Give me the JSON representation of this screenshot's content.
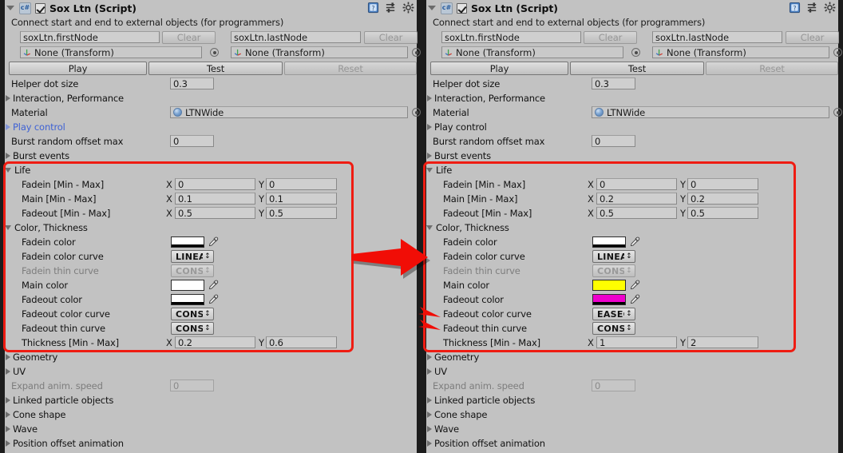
{
  "component": {
    "title": "Sox Ltn (Script)",
    "enabled_checkbox": true,
    "script_icon": "c#",
    "help_text": "Connect start and end to external objects (for programmers)",
    "icons": [
      "help-icon",
      "preset-icon",
      "gear-icon"
    ]
  },
  "node_fields": {
    "first_node_value": "soxLtn.firstNode",
    "last_node_value": "soxLtn.lastNode",
    "clear_label": "Clear",
    "first_object_value": "None (Transform)",
    "last_object_value": "None (Transform)"
  },
  "action_buttons": {
    "play": "Play",
    "test": "Test",
    "reset": "Reset"
  },
  "common_rows": {
    "helper_dot_size_label": "Helper dot size",
    "helper_dot_size_value": "0.3",
    "interaction_performance": "Interaction, Performance",
    "material_label": "Material",
    "material_value": "LTNWide",
    "play_control": "Play control",
    "burst_random_label": "Burst random offset max",
    "burst_random_value": "0",
    "burst_events": "Burst events"
  },
  "life": {
    "header": "Life",
    "rows": [
      {
        "label": "Fadein   [Min - Max]",
        "x_label": "X",
        "y_label": "Y"
      },
      {
        "label": "Main     [Min - Max]",
        "x_label": "X",
        "y_label": "Y"
      },
      {
        "label": "Fadeout [Min - Max]",
        "x_label": "X",
        "y_label": "Y"
      }
    ]
  },
  "color_thickness": {
    "header": "Color, Thickness",
    "labels": {
      "fadein_color": "Fadein color",
      "fadein_color_curve": "Fadein color curve",
      "fadein_thin_curve": "Fadein thin curve",
      "main_color": "Main color",
      "fadeout_color": "Fadeout color",
      "fadeout_color_curve": "Fadeout color curve",
      "fadeout_thin_curve": "Fadeout thin curve",
      "thickness": "Thickness [Min - Max]",
      "x_label": "X",
      "y_label": "Y"
    }
  },
  "bottom_rows": {
    "geometry": "Geometry",
    "uv": "UV",
    "expand_anim_label": "Expand anim. speed",
    "expand_anim_value": "0",
    "linked_particle_objects": "Linked particle objects",
    "cone_shape": "Cone shape",
    "wave": "Wave",
    "position_offset_animation": "Position offset animation"
  },
  "left_panel": {
    "play_control_highlighted": true,
    "life": {
      "fadein": {
        "x": "0",
        "y": "0"
      },
      "main": {
        "x": "0.1",
        "y": "0.1"
      },
      "fadeout": {
        "x": "0.5",
        "y": "0.5"
      }
    },
    "colors": {
      "fadein_color": "#ffffff",
      "fadein_alpha": "#000000",
      "main_color": "#ffffff",
      "main_alpha": "#ffffff",
      "fadeout_color": "#ffffff",
      "fadeout_alpha": "#000000"
    },
    "curves": {
      "fadein_color_curve": "LINEAR",
      "fadein_thin_curve": "CONST",
      "fadeout_color_curve": "CONST",
      "fadeout_thin_curve": "CONST"
    },
    "thickness": {
      "x": "0.2",
      "y": "0.6"
    }
  },
  "right_panel": {
    "play_control_highlighted": false,
    "life": {
      "fadein": {
        "x": "0",
        "y": "0"
      },
      "main": {
        "x": "0.2",
        "y": "0.2"
      },
      "fadeout": {
        "x": "0.5",
        "y": "0.5"
      }
    },
    "colors": {
      "fadein_color": "#ffffff",
      "fadein_alpha": "#000000",
      "main_color": "#ffff00",
      "main_alpha": "#ffff00",
      "fadeout_color": "#ee00cc",
      "fadeout_alpha": "#000000"
    },
    "curves": {
      "fadein_color_curve": "LINEAR",
      "fadein_thin_curve": "CONST",
      "fadeout_color_curve": "EASEO",
      "fadeout_thin_curve": "CONST"
    },
    "thickness": {
      "x": "1",
      "y": "2"
    }
  },
  "annotations": {
    "accent_color": "#ef1c12",
    "big_arrow": "right-arrow-annotation",
    "small_arrows": [
      "fadeout-color-curve-arrow",
      "fadeout-thin-curve-arrow"
    ],
    "highlight_boxes": [
      "left-life-color-highlight",
      "right-life-color-highlight"
    ]
  }
}
